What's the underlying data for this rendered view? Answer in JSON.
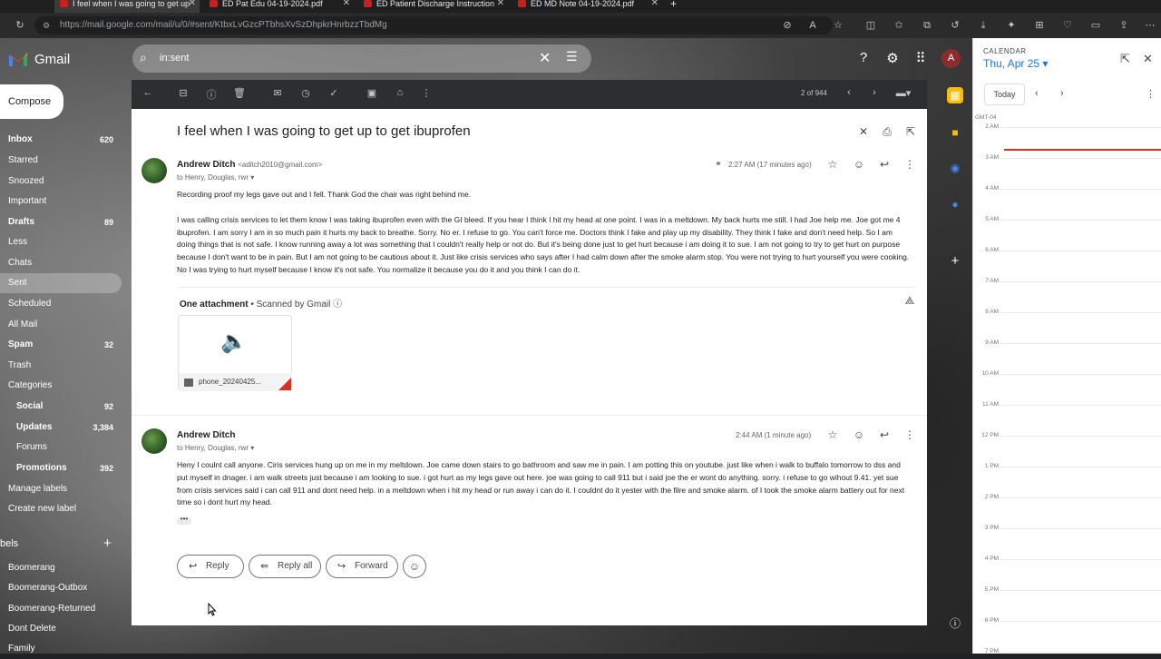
{
  "browser": {
    "tabs": [
      {
        "title": "I feel when I was going to get up",
        "active": true
      },
      {
        "title": "ED Pat Edu 04-19-2024.pdf",
        "active": false
      },
      {
        "title": "ED Patient Discharge Instruction",
        "active": false
      },
      {
        "title": "ED MD Note 04-19-2024.pdf",
        "active": false
      }
    ],
    "url": "https://mail.google.com/mail/u/0/#sent/KtbxLvGzcPTbhsXvSzDhpkrHnrbzzTbdMg"
  },
  "gmail": {
    "logo_text": "Gmail",
    "search": {
      "value": "in:sent"
    },
    "avatar_letter": "A",
    "compose_label": "Compose",
    "nav": [
      {
        "label": "Inbox",
        "count": "620",
        "bold": true
      },
      {
        "label": "Starred",
        "count": ""
      },
      {
        "label": "Snoozed",
        "count": ""
      },
      {
        "label": "Important",
        "count": ""
      },
      {
        "label": "Drafts",
        "count": "89",
        "bold": true
      },
      {
        "label": "Less",
        "count": ""
      },
      {
        "label": "Chats",
        "count": ""
      },
      {
        "label": "Sent",
        "count": "",
        "selected": true
      },
      {
        "label": "Scheduled",
        "count": ""
      },
      {
        "label": "All Mail",
        "count": ""
      },
      {
        "label": "Spam",
        "count": "32",
        "bold": true
      },
      {
        "label": "Trash",
        "count": ""
      },
      {
        "label": "Categories",
        "count": ""
      },
      {
        "label": "Social",
        "count": "92",
        "bold": true
      },
      {
        "label": "Updates",
        "count": "3,384",
        "bold": true
      },
      {
        "label": "Forums",
        "count": ""
      },
      {
        "label": "Promotions",
        "count": "392",
        "bold": true
      },
      {
        "label": "Manage labels",
        "count": ""
      },
      {
        "label": "Create new label",
        "count": ""
      }
    ],
    "labels_header": "bels",
    "labels": [
      "Boomerang",
      "Boomerang-Outbox",
      "Boomerang-Returned",
      "Dont Delete",
      "Family"
    ],
    "pager": "2 of 944",
    "thread": {
      "subject": "I feel when I was going to get up to get ibuprofen",
      "messages": [
        {
          "sender": "Andrew Ditch",
          "email": "<aditch2010@gmail.com>",
          "to": "to Henry, Douglas, rwr",
          "time": "2:27 AM (17 minutes ago)",
          "paragraphs": [
            "Recording proof my legs gave out and I fell. Thank God the chair was right behind me.",
            "I was calling crisis services to let them know I was taking ibuprofen even with the GI bleed. If you hear I think I hit my head at one point. I was in a meltdown. My back hurts me still. I had Joe help me. Joe got me 4 ibuprofen. I am sorry I am in so much pain it hurts my back to breathe. Sorry. No er. I refuse to go. You can't force me. Doctors think I fake and play up my disability. They think I fake and don't need help. So I am doing things that is not safe. I know running away a lot was something that I couldn't really help or not do. But it's being done just to get hurt because i am doing it to sue. I am not going to try to get hurt on purpose because I don't want to be in pain. But I am not going to be cautious about it. Just like crisis services who says after I had calm down after the smoke alarm stop. You were not trying to hurt yourself you were cooking. No I was trying to hurt myself because I know it's not safe. You normalize it because you do it and you think I can do it."
          ],
          "attachment_header": "One attachment",
          "scanned": "Scanned by Gmail",
          "attachment_name": "phone_20240425..."
        },
        {
          "sender": "Andrew Ditch",
          "to": "to Henry, Douglas, rwr",
          "time": "2:44 AM (1 minute ago)",
          "paragraphs": [
            "Heny I coulnt call anyone. Ciris services hung up on me in my meltdown. Joe came down stairs to go bathroom and saw me in pain. I am potting this on youtube. just like when i walk to buffalo tomorrow to dss and put myself in dnager. i am walk streets just because i am looking to sue. i got hurt as my legs gave out here. joe was going to call 911 but i said joe the er wont do anything. sorry. i refuse to go wihout 9.41. yet sue from crisis services said i can call 911 and dont need help. in a meltdown when i hit my head or run away i can do it. I couldnt do it yester with the filre and smoke alarm. of I took the smoke alarm battery out for next time so i dont hurt my head."
          ],
          "ellipsis": "•••"
        }
      ],
      "reply_label": "Reply",
      "reply_all_label": "Reply all",
      "forward_label": "Forward"
    }
  },
  "calendar": {
    "header": "CALENDAR",
    "date": "Thu, Apr 25",
    "today_label": "Today",
    "timezone": "GMT-04",
    "hours": [
      "2 AM",
      "3 AM",
      "4 AM",
      "5 AM",
      "6 AM",
      "7 AM",
      "8 AM",
      "9 AM",
      "10 AM",
      "11 AM",
      "12 PM",
      "1 PM",
      "2 PM",
      "3 PM",
      "4 PM",
      "5 PM",
      "6 PM",
      "7 PM"
    ]
  },
  "colors": {
    "accent": "#1a73e8",
    "now_line": "#d93025",
    "toolbar": "#2d2e30"
  }
}
